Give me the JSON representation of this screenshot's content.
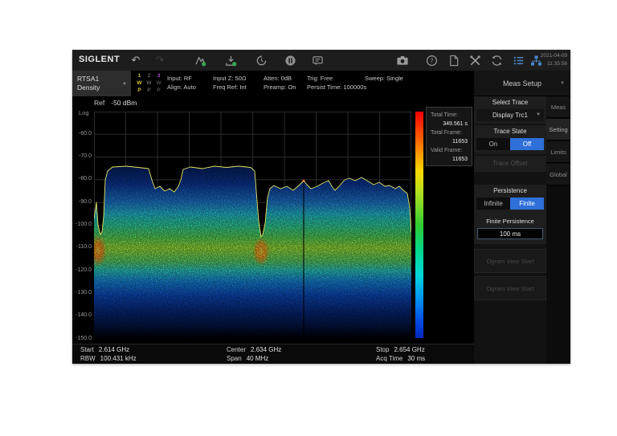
{
  "toolbar": {
    "brand": "SIGLENT",
    "date": "2021-04-09",
    "time": "11:35:56",
    "undo_glyph": "↶",
    "redo_glyph": "↷"
  },
  "statusbar": {
    "mode": "RTSA1",
    "view": "Density",
    "traces": [
      {
        "num": "1",
        "w": "W",
        "p": "P"
      },
      {
        "num": "2",
        "w": "W",
        "p": "P"
      },
      {
        "num": "3",
        "w": "W",
        "p": "P"
      }
    ],
    "params": [
      {
        "l1": "Input: RF",
        "l2": "Align: Auto"
      },
      {
        "l1": "Input Z: 50Ω",
        "l2": "Freq Ref: Int"
      },
      {
        "l1": "Atten: 0dB",
        "l2": "Preamp: On"
      },
      {
        "l1": "Trig: Free",
        "l2": "Persist Time: 100000s"
      },
      {
        "l1": "Sweep: Single",
        "l2": ""
      }
    ]
  },
  "chart": {
    "ref_label": "Ref",
    "ref_value": "-50 dBm",
    "scale": "Log",
    "y_ticks": [
      "-60.0",
      "-70.0",
      "-80.0",
      "-90.0",
      "-100.0",
      "-110.0",
      "-120.0",
      "-130.0",
      "-140.0",
      "-150.0"
    ],
    "info": {
      "rows": [
        {
          "label": "Total Time:",
          "value": "349.561 s"
        },
        {
          "label": "Total Frame:",
          "value": "11653"
        },
        {
          "label": "Valid Frame:",
          "value": "11653"
        }
      ]
    },
    "footer": {
      "start_label": "Start",
      "start_value": "2.614 GHz",
      "center_label": "Center",
      "center_value": "2.634 GHz",
      "stop_label": "Stop",
      "stop_value": "2.654 GHz",
      "rbw_label": "RBW",
      "rbw_value": "100.431 kHz",
      "span_label": "Span",
      "span_value": "40 MHz",
      "acq_label": "Acq Time",
      "acq_value": "30 ms"
    }
  },
  "sidebar": {
    "title": "Meas Setup",
    "select_trace": "Select Trace",
    "trace_dropdown": "Display Trc1",
    "trace_state": "Trace State",
    "on": "On",
    "off": "Off",
    "trace_offset": "Trace Offset",
    "persistence": "Persistence",
    "infinite": "Infinite",
    "finite": "Finite",
    "finite_persistence": "Finite Persistence",
    "finite_value": "100 ms",
    "ogram1": "Ogram View Start",
    "ogram2": "Ogram View Start",
    "tabs": [
      "Meas",
      "Setting",
      "Limits",
      "Global"
    ],
    "active_tab": "Setting"
  },
  "colors": {
    "accent_blue": "#2e6fd8",
    "trace_yellow": "#e4e45f",
    "trace1_color": "#d8c832",
    "trace3_color": "#b44fd8",
    "icon_blue": "#4a86c8",
    "colormap": [
      "#f00000",
      "#ffd800",
      "#30cc30",
      "#00d8d8",
      "#0048e0"
    ]
  }
}
